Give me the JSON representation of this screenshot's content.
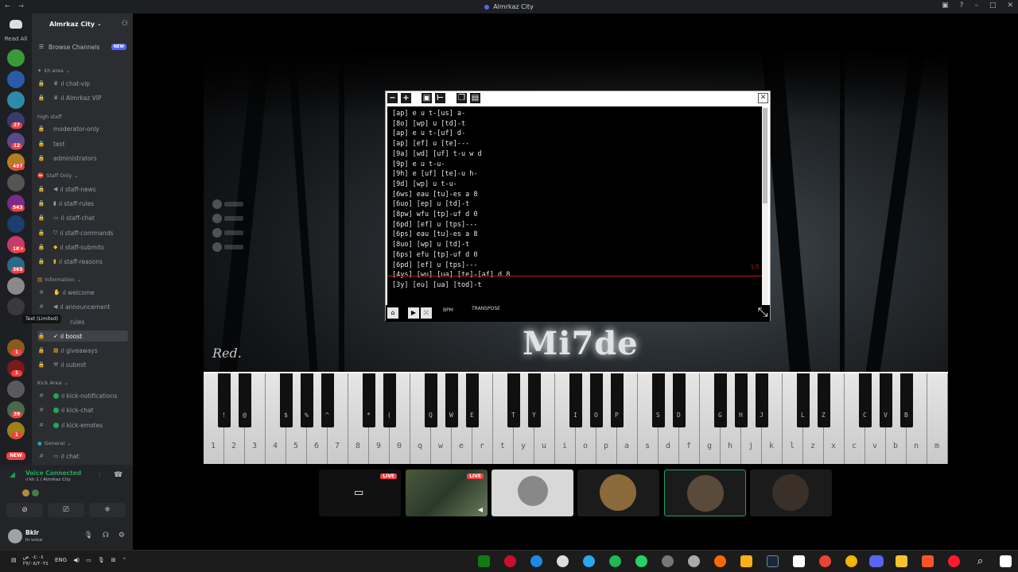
{
  "window": {
    "title": "Almrkaz City"
  },
  "rail": {
    "read_all": "Read All",
    "new_badge": "NEW",
    "badges": [
      "27",
      "12",
      "497",
      "543",
      "1K+",
      "365",
      "1",
      "1",
      "39",
      "1"
    ]
  },
  "server": {
    "name": "Almrkaz City",
    "browse_label": "Browse Channels",
    "new_badge": "NEW"
  },
  "categories": [
    {
      "label": "kh area"
    },
    {
      "label": "high staff"
    },
    {
      "label": "Staff Only"
    },
    {
      "label": "Information"
    },
    {
      "label": "Kick Area"
    },
    {
      "label": "General"
    }
  ],
  "channels": [
    "ıl chat-vip",
    "ıl Almrkaz VIP",
    "moderator-only",
    "test",
    "administrators",
    "ıl staff-news",
    "ıl staff-rules",
    "ıl staff-chat",
    "ıl staff-commands",
    "ıl staff-submits",
    "ıl staff-reasons",
    "ıl welcome",
    "ıl announcement",
    "rules",
    "ıl boost",
    "ıl giveaways",
    "ıl submit",
    "ıl kick-notifications",
    "ıl kick-chat",
    "ıl kick-emotes",
    "ıl chat"
  ],
  "tooltip": "Text (Limited)",
  "voice": {
    "status": "Voice Connected",
    "location": "ıl kh 1 / Almrkaz City"
  },
  "user": {
    "name": "Bklr",
    "status": "In voice"
  },
  "panel": {
    "sheet": [
      "[ap] e u t-[us] a-",
      "[8o] [wp] u [td]-t",
      "[ap] e u t-[uf] d-",
      "[ap] [ef] u [te]---",
      "[9a] [wd] [uf] t-u w d",
      "[9p] e u t-u-",
      "[9h] e [uf] [te]-u h-",
      "[9d] [wp] u t-u-",
      "[6ws] eau [tu]-es a 8",
      "[6uo] [ep] u [td]-t",
      "[8pw] wfu [tp]-uf d 0",
      "[6pd] [ef] u [tps]---",
      "[6ps] eau [tu]-es a 8",
      "[8uo] [wp] u [td]-t",
      "[6ps] efu [tp]-uf d 0",
      "[6pd] [ef] u [tps]---",
      "[4ys] [wu] [ua] [te]-[af] d 8",
      "[3y] [eu] [ua] [tod]-t"
    ],
    "progress": "1/5",
    "bpm_label": "BPM",
    "transpose_label": "TRANSPOSE"
  },
  "scene": {
    "watermark": "Mi7de",
    "logo": "Red."
  },
  "piano": {
    "white_labels": [
      "1",
      "2",
      "3",
      "4",
      "5",
      "6",
      "7",
      "8",
      "9",
      "0",
      "q",
      "w",
      "e",
      "r",
      "t",
      "y",
      "u",
      "i",
      "o",
      "p",
      "a",
      "s",
      "d",
      "f",
      "g",
      "h",
      "j",
      "k",
      "l",
      "z",
      "x",
      "c",
      "v",
      "b",
      "n",
      "m"
    ],
    "black_labels": [
      "!",
      "@",
      "$",
      "%",
      "^",
      "*",
      "(",
      "Q",
      "W",
      "E",
      "T",
      "Y",
      "I",
      "O",
      "P",
      "S",
      "D",
      "G",
      "H",
      "J",
      "L",
      "Z",
      "C",
      "V",
      "B"
    ]
  },
  "tiles": {
    "live1": "LIVE",
    "live2": "LIVE"
  },
  "taskbar": {
    "lang": "ENG",
    "time": "٠٤:٠٤ ص",
    "date": "٢٧/٠٨/٢٠٢٤"
  },
  "colors": {
    "accent": "#5865f2",
    "online": "#23a559",
    "danger": "#f23f42"
  }
}
